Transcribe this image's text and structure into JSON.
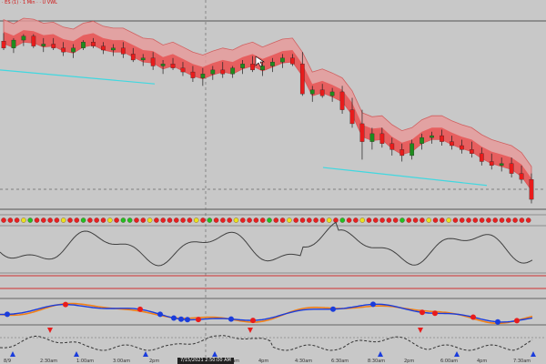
{
  "window": {
    "symbol_label": "· ES (1) · 1 Min · · U  VWL",
    "cursor_time": "7/15/2021 2:50:00 AM"
  },
  "colors": {
    "background": "#c8c8c8",
    "bull_candle": "#1e8c1e",
    "bear_candle": "#e81c1c",
    "band_fill": "#e89898",
    "band_inner": "#e84848",
    "trend_line": "#40d8e0",
    "oscillator_line": "#404040",
    "divider_red": "#d03030",
    "fast_ma": "#1a3cdc",
    "slow_ma": "#f08018"
  },
  "x_axis": {
    "tick_labels": [
      "8/9",
      "2:30am",
      "1:00am",
      "3:00am",
      "2pm",
      "3:30pm",
      "2:30am",
      "4pm",
      "4:30am",
      "6:30am",
      "8:30am",
      "2pm",
      "6:00am",
      "4pm",
      "7:30am"
    ]
  },
  "status_dots": [
    "r",
    "r",
    "r",
    "y",
    "g",
    "r",
    "r",
    "r",
    "r",
    "y",
    "r",
    "r",
    "g",
    "r",
    "r",
    "r",
    "y",
    "r",
    "g",
    "g",
    "r",
    "r",
    "y",
    "r",
    "r",
    "r",
    "r",
    "r",
    "r",
    "y",
    "r",
    "g",
    "r",
    "r",
    "r",
    "y",
    "r",
    "r",
    "r",
    "r",
    "g",
    "r",
    "r",
    "y",
    "r",
    "r",
    "r",
    "r",
    "r",
    "y",
    "r",
    "g",
    "r",
    "r",
    "y",
    "r",
    "r",
    "r",
    "r",
    "r",
    "g",
    "r",
    "r",
    "r",
    "y",
    "r",
    "r",
    "y",
    "r",
    "r",
    "r",
    "r",
    "r",
    "r",
    "r",
    "r",
    "r",
    "r",
    "r",
    "r"
  ],
  "chart_data": {
    "type": "candlestick",
    "series": [
      {
        "name": "",
        "values": [
          {
            "o": 63,
            "h": 55,
            "l": 72,
            "c": 70
          },
          {
            "o": 70,
            "h": 60,
            "l": 75,
            "c": 62
          },
          {
            "o": 62,
            "h": 56,
            "l": 68,
            "c": 58
          },
          {
            "o": 58,
            "h": 56,
            "l": 70,
            "c": 68
          },
          {
            "o": 68,
            "h": 60,
            "l": 74,
            "c": 66
          },
          {
            "o": 66,
            "h": 60,
            "l": 72,
            "c": 70
          },
          {
            "o": 70,
            "h": 64,
            "l": 78,
            "c": 74
          },
          {
            "o": 74,
            "h": 66,
            "l": 80,
            "c": 70
          },
          {
            "o": 70,
            "h": 62,
            "l": 72,
            "c": 64
          },
          {
            "o": 64,
            "h": 60,
            "l": 70,
            "c": 68
          },
          {
            "o": 68,
            "h": 64,
            "l": 76,
            "c": 72
          },
          {
            "o": 72,
            "h": 66,
            "l": 78,
            "c": 70
          },
          {
            "o": 70,
            "h": 64,
            "l": 80,
            "c": 76
          },
          {
            "o": 76,
            "h": 70,
            "l": 84,
            "c": 82
          },
          {
            "o": 82,
            "h": 76,
            "l": 88,
            "c": 80
          },
          {
            "o": 80,
            "h": 74,
            "l": 92,
            "c": 88
          },
          {
            "o": 88,
            "h": 82,
            "l": 96,
            "c": 86
          },
          {
            "o": 86,
            "h": 80,
            "l": 92,
            "c": 90
          },
          {
            "o": 90,
            "h": 84,
            "l": 98,
            "c": 94
          },
          {
            "o": 94,
            "h": 88,
            "l": 104,
            "c": 100
          },
          {
            "o": 100,
            "h": 90,
            "l": 108,
            "c": 96
          },
          {
            "o": 96,
            "h": 88,
            "l": 102,
            "c": 92
          },
          {
            "o": 92,
            "h": 84,
            "l": 100,
            "c": 96
          },
          {
            "o": 96,
            "h": 88,
            "l": 100,
            "c": 90
          },
          {
            "o": 90,
            "h": 82,
            "l": 96,
            "c": 86
          },
          {
            "o": 86,
            "h": 78,
            "l": 94,
            "c": 92
          },
          {
            "o": 92,
            "h": 84,
            "l": 98,
            "c": 88
          },
          {
            "o": 88,
            "h": 80,
            "l": 94,
            "c": 84
          },
          {
            "o": 84,
            "h": 76,
            "l": 90,
            "c": 80
          },
          {
            "o": 80,
            "h": 76,
            "l": 88,
            "c": 86
          },
          {
            "o": 86,
            "h": 74,
            "l": 118,
            "c": 116
          },
          {
            "o": 116,
            "h": 108,
            "l": 124,
            "c": 112
          },
          {
            "o": 112,
            "h": 106,
            "l": 120,
            "c": 118
          },
          {
            "o": 118,
            "h": 110,
            "l": 124,
            "c": 114
          },
          {
            "o": 114,
            "h": 108,
            "l": 136,
            "c": 132
          },
          {
            "o": 132,
            "h": 120,
            "l": 150,
            "c": 146
          },
          {
            "o": 146,
            "h": 132,
            "l": 182,
            "c": 164
          },
          {
            "o": 164,
            "h": 150,
            "l": 172,
            "c": 156
          },
          {
            "o": 156,
            "h": 150,
            "l": 170,
            "c": 166
          },
          {
            "o": 166,
            "h": 160,
            "l": 178,
            "c": 172
          },
          {
            "o": 172,
            "h": 166,
            "l": 184,
            "c": 178
          },
          {
            "o": 178,
            "h": 162,
            "l": 182,
            "c": 166
          },
          {
            "o": 166,
            "h": 156,
            "l": 172,
            "c": 160
          },
          {
            "o": 160,
            "h": 154,
            "l": 166,
            "c": 158
          },
          {
            "o": 158,
            "h": 152,
            "l": 168,
            "c": 164
          },
          {
            "o": 164,
            "h": 158,
            "l": 172,
            "c": 168
          },
          {
            "o": 168,
            "h": 162,
            "l": 176,
            "c": 172
          },
          {
            "o": 172,
            "h": 164,
            "l": 180,
            "c": 176
          },
          {
            "o": 176,
            "h": 170,
            "l": 188,
            "c": 184
          },
          {
            "o": 184,
            "h": 176,
            "l": 192,
            "c": 188
          },
          {
            "o": 188,
            "h": 180,
            "l": 194,
            "c": 186
          },
          {
            "o": 186,
            "h": 180,
            "l": 200,
            "c": 196
          },
          {
            "o": 196,
            "h": 188,
            "l": 206,
            "c": 202
          },
          {
            "o": 202,
            "h": 196,
            "l": 226,
            "c": 222
          }
        ]
      }
    ]
  }
}
